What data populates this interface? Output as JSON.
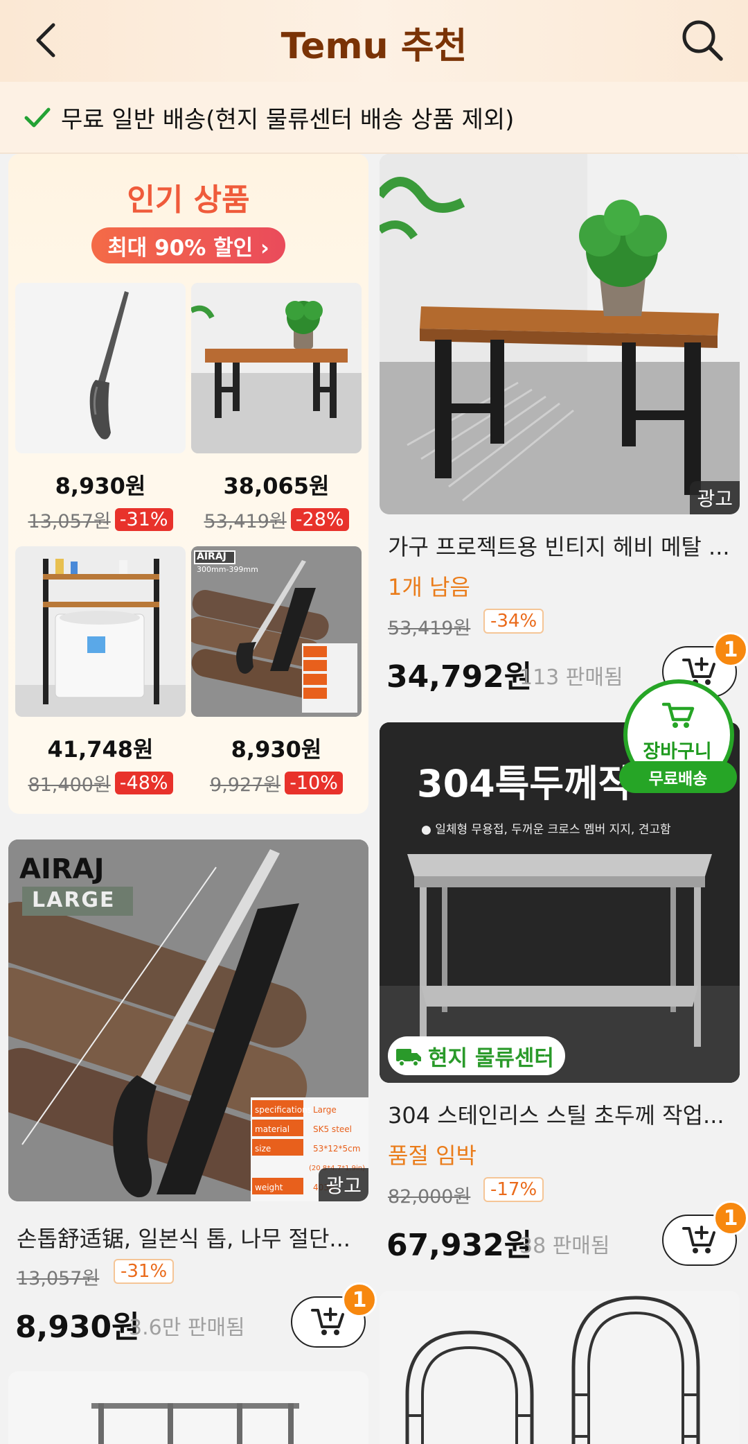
{
  "header": {
    "title": "Temu 추천"
  },
  "shipping_banner": {
    "text": "무료 일반 배송(현지 물류센터 배송 상품 제외)"
  },
  "promo": {
    "title": "인기 상품",
    "pill": "최대 90% 할인 ›",
    "items": [
      {
        "price": "8,930원",
        "original": "13,057원",
        "discount": "-31%"
      },
      {
        "price": "38,065원",
        "original": "53,419원",
        "discount": "-28%"
      },
      {
        "price": "41,748원",
        "original": "81,400원",
        "discount": "-48%"
      },
      {
        "price": "8,930원",
        "original": "9,927원",
        "discount": "-10%"
      }
    ],
    "mini_saw_brand": "AIRAJ",
    "mini_saw_size": "300mm-399mm"
  },
  "products": [
    {
      "name": "가구 프로젝트용 빈티지 헤비 메탈 ...",
      "note": "1개 남음",
      "original": "53,419원",
      "discount": "-34%",
      "price": "34,792원",
      "sold": "113 판매됨",
      "cart_count": "1",
      "ad": "광고"
    },
    {
      "name": "304 스테인리스 스틸 초두께 작업...",
      "note": "품절 임박",
      "original": "82,000원",
      "discount": "-17%",
      "price": "67,932원",
      "sold": "38 판매됨",
      "cart_count": "1",
      "image_text": "304특두께작",
      "image_sub": "● 일체형 무용접, 두꺼운 크로스 멤버 지지, 견고함",
      "local_tag": "현지 물류센터"
    },
    {
      "name": "손톱舒适锯, 일본식 톱, 나무 절단...",
      "original": "13,057원",
      "discount": "-31%",
      "price": "8,930원",
      "sold": "3.6만 판매됨",
      "cart_count": "1",
      "ad": "광고",
      "brand": "AIRAJ",
      "brand_sub": "LARGE",
      "spec_rows": [
        [
          "specifications",
          "Large"
        ],
        [
          "material",
          "SK5 steel"
        ],
        [
          "size",
          "53*12*5cm"
        ],
        [
          "",
          "(20.8*4.7*1.9in)"
        ],
        [
          "weight",
          "403g"
        ]
      ]
    }
  ],
  "floating_cart": {
    "label": "장바구니",
    "free": "무료배송"
  },
  "colors": {
    "accent": "#ea7c1a",
    "green": "#26a526",
    "discount_red": "#e8322b",
    "title_brown": "#7a3306"
  }
}
